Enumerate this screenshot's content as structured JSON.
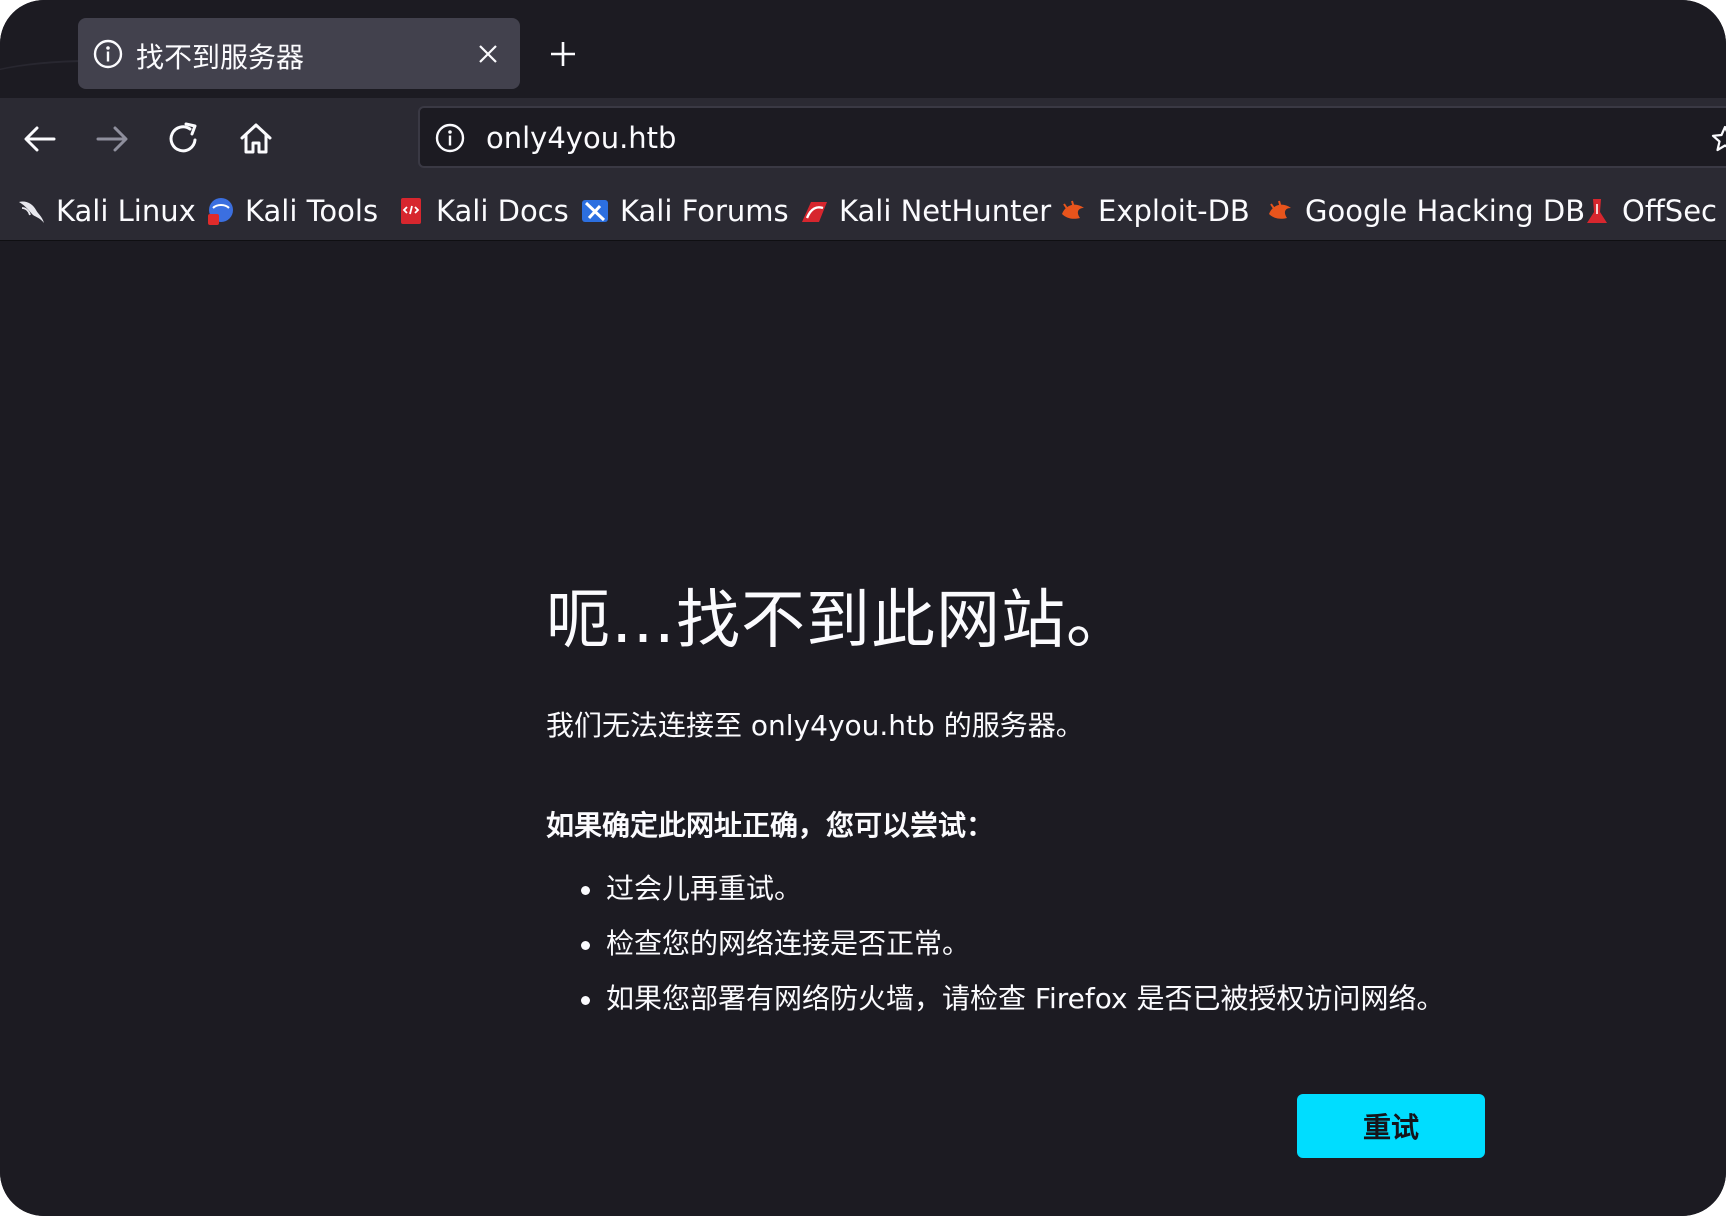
{
  "tab": {
    "title": "找不到服务器",
    "info_icon": "info-icon",
    "close_icon": "close-icon",
    "new_tab_icon": "plus-icon"
  },
  "toolbar": {
    "back_icon": "back-arrow-icon",
    "forward_icon": "forward-arrow-icon",
    "reload_icon": "reload-icon",
    "home_icon": "home-icon"
  },
  "urlbar": {
    "url": "only4you.htb",
    "info_icon": "info-icon",
    "bookmark_icon": "star-icon"
  },
  "bookmarks": [
    {
      "label": "Kali Linux",
      "icon": "kali-dragon-icon"
    },
    {
      "label": "Kali Tools",
      "icon": "kali-tools-icon"
    },
    {
      "label": "Kali Docs",
      "icon": "kali-docs-icon"
    },
    {
      "label": "Kali Forums",
      "icon": "kali-forums-icon"
    },
    {
      "label": "Kali NetHunter",
      "icon": "kali-nethunter-icon"
    },
    {
      "label": "Exploit-DB",
      "icon": "exploit-db-icon"
    },
    {
      "label": "Google Hacking DB",
      "icon": "google-hacking-db-icon"
    },
    {
      "label": "OffSec",
      "icon": "offsec-icon"
    }
  ],
  "error": {
    "title": "呃…找不到此网站。",
    "description": "我们无法连接至 only4you.htb 的服务器。",
    "suggestion_heading": "如果确定此网址正确，您可以尝试：",
    "suggestions": [
      "过会儿再重试。",
      "检查您的网络连接是否正常。",
      "如果您部署有网络防火墙，请检查 Firefox 是否已被授权访问网络。"
    ],
    "retry_label": "重试"
  },
  "colors": {
    "background": "#1c1b22",
    "toolbar": "#2b2a33",
    "tab_active": "#42414d",
    "accent": "#00ddff",
    "text": "#fbfbfe"
  }
}
